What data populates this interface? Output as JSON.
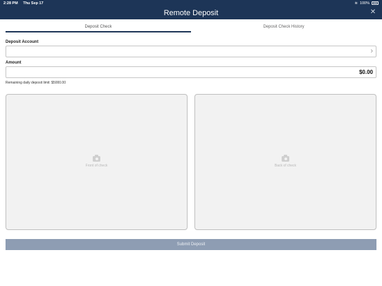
{
  "status_bar": {
    "time": "2:28 PM",
    "date": "Thu Sep 17",
    "battery": "100%"
  },
  "header": {
    "title": "Remote Deposit"
  },
  "tabs": [
    {
      "label": "Deposit Check"
    },
    {
      "label": "Deposit Check History"
    }
  ],
  "form": {
    "account_label": "Deposit Account",
    "account_value": "",
    "amount_label": "Amount",
    "amount_value": "$0.00",
    "limit_text": "Remaining daily deposit limit: $5000.00"
  },
  "checks": {
    "front_label": "Front of check",
    "back_label": "Back of check"
  },
  "submit_label": "Submit Deposit",
  "colors": {
    "header": "#1d3557",
    "submit": "#8e9db3"
  }
}
